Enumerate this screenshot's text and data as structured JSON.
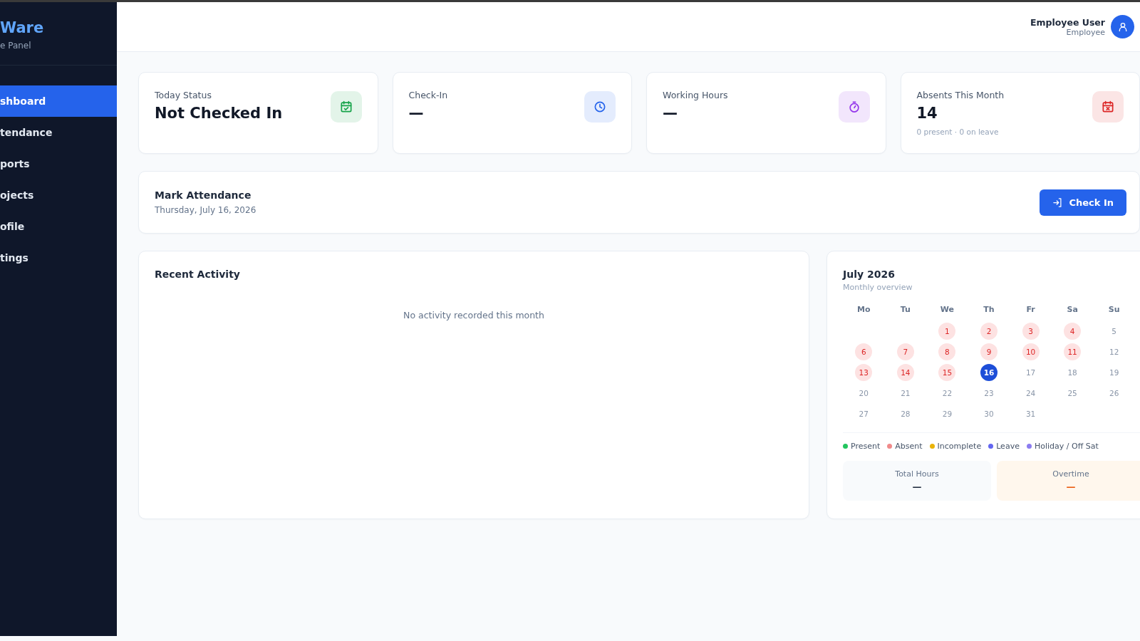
{
  "sidebar": {
    "brand": "Ware",
    "subtitle": "e Panel",
    "items": [
      {
        "label": "shboard",
        "selected": true
      },
      {
        "label": "tendance",
        "selected": false
      },
      {
        "label": "ports",
        "selected": false
      },
      {
        "label": "ojects",
        "selected": false
      },
      {
        "label": "ofile",
        "selected": false
      },
      {
        "label": "tings",
        "selected": false
      }
    ]
  },
  "header": {
    "user_name": "Employee User",
    "user_role": "Employee"
  },
  "stats": [
    {
      "label": "Today Status",
      "value": "Not Checked In",
      "kind": "status",
      "color": "#16a34a"
    },
    {
      "label": "Check-In",
      "value": "—",
      "kind": "check-in",
      "color": "#2563eb"
    },
    {
      "label": "Working Hours",
      "value": "—",
      "kind": "hours",
      "color": "#9333ea"
    },
    {
      "label": "Absents This Month",
      "value": "14",
      "note": "0 present · 0 on leave",
      "kind": "absents",
      "color": "#dc2626"
    }
  ],
  "mark_attendance": {
    "title": "Mark Attendance",
    "date": "Thursday, July 16, 2026",
    "button": "Check In"
  },
  "recent_activity": {
    "title": "Recent Activity",
    "empty_text": "No activity recorded this month"
  },
  "calendar": {
    "title": "July 2026",
    "subtitle": "Monthly overview",
    "weekdays": [
      "Mo",
      "Tu",
      "We",
      "Th",
      "Fr",
      "Sa",
      "Su"
    ],
    "weeks": [
      [
        {
          "kind": "blank"
        },
        {
          "kind": "blank"
        },
        {
          "day": "1",
          "kind": "absent"
        },
        {
          "day": "2",
          "kind": "absent"
        },
        {
          "day": "3",
          "kind": "absent"
        },
        {
          "day": "4",
          "kind": "absent"
        },
        {
          "day": "5",
          "kind": "off"
        }
      ],
      [
        {
          "day": "6",
          "kind": "absent"
        },
        {
          "day": "7",
          "kind": "absent"
        },
        {
          "day": "8",
          "kind": "absent"
        },
        {
          "day": "9",
          "kind": "absent"
        },
        {
          "day": "10",
          "kind": "absent"
        },
        {
          "day": "11",
          "kind": "absent"
        },
        {
          "day": "12",
          "kind": "off"
        }
      ],
      [
        {
          "day": "13",
          "kind": "absent"
        },
        {
          "day": "14",
          "kind": "absent"
        },
        {
          "day": "15",
          "kind": "absent"
        },
        {
          "day": "16",
          "kind": "today"
        },
        {
          "day": "17",
          "kind": "future"
        },
        {
          "day": "18",
          "kind": "future"
        },
        {
          "day": "19",
          "kind": "off"
        }
      ],
      [
        {
          "day": "20",
          "kind": "future"
        },
        {
          "day": "21",
          "kind": "future"
        },
        {
          "day": "22",
          "kind": "future"
        },
        {
          "day": "23",
          "kind": "future"
        },
        {
          "day": "24",
          "kind": "future"
        },
        {
          "day": "25",
          "kind": "future"
        },
        {
          "day": "26",
          "kind": "off"
        }
      ],
      [
        {
          "day": "27",
          "kind": "future"
        },
        {
          "day": "28",
          "kind": "future"
        },
        {
          "day": "29",
          "kind": "future"
        },
        {
          "day": "30",
          "kind": "future"
        },
        {
          "day": "31",
          "kind": "future"
        },
        {
          "kind": "blank"
        },
        {
          "kind": "blank"
        }
      ]
    ],
    "legend": [
      {
        "label": "Present",
        "color": "#22c55e"
      },
      {
        "label": "Absent",
        "color": "#f08a8a"
      },
      {
        "label": "Incomplete",
        "color": "#eab308"
      },
      {
        "label": "Leave",
        "color": "#6366f1"
      },
      {
        "label": "Holiday / Off Sat",
        "color": "#8b7cf0"
      }
    ],
    "totals": [
      {
        "label": "Total Hours",
        "value": "—",
        "kind": "hours"
      },
      {
        "label": "Overtime",
        "value": "—",
        "kind": "overtime"
      }
    ]
  }
}
